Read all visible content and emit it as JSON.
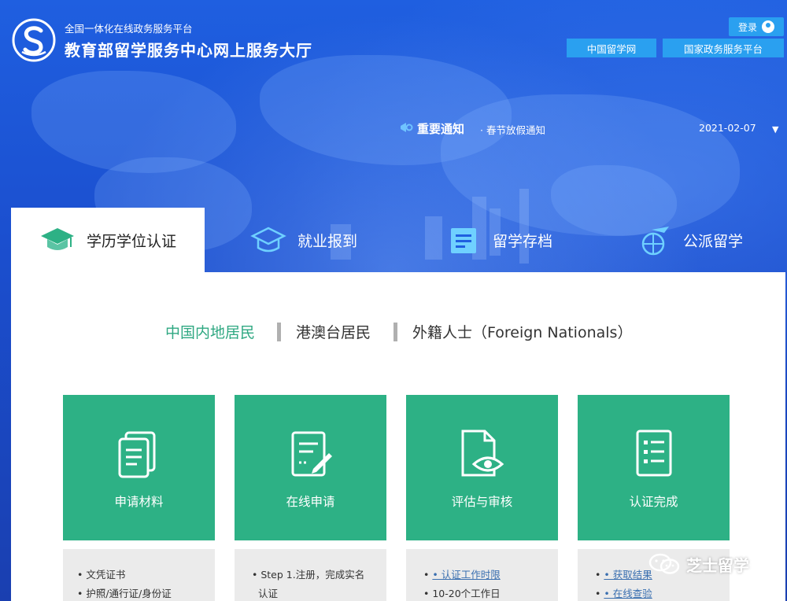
{
  "brand": {
    "subtitle": "全国一体化在线政务服务平台",
    "title": "教育部留学服务中心网上服务大厅"
  },
  "header": {
    "login_label": "登录",
    "links": [
      "中国留学网",
      "国家政务服务平台"
    ]
  },
  "notice": {
    "title": "重要通知",
    "item": "· 春节放假通知",
    "date": "2021-02-07",
    "caret": "▼"
  },
  "tabs": [
    {
      "label": "学历学位认证",
      "icon": "graduation-cap-icon",
      "active": true
    },
    {
      "label": "就业报到",
      "icon": "mortarboard-icon",
      "active": false
    },
    {
      "label": "留学存档",
      "icon": "archive-folder-icon",
      "active": false
    },
    {
      "label": "公派留学",
      "icon": "airplane-globe-icon",
      "active": false
    }
  ],
  "segments": [
    {
      "label": "中国内地居民",
      "active": true
    },
    {
      "label": "港澳台居民",
      "active": false
    },
    {
      "label": "外籍人士（Foreign Nationals）",
      "active": false
    }
  ],
  "steps": [
    {
      "label": "申请材料",
      "icon": "documents-icon"
    },
    {
      "label": "在线申请",
      "icon": "form-edit-icon"
    },
    {
      "label": "评估与审核",
      "icon": "document-eye-icon"
    },
    {
      "label": "认证完成",
      "icon": "checklist-icon"
    }
  ],
  "info": [
    {
      "lines": [
        "• 文凭证书",
        "• 护照/通行证/身份证"
      ]
    },
    {
      "lines": [
        "• Step 1.注册，完成实名",
        "认证"
      ]
    },
    {
      "lines": [
        "• 认证工作时限",
        "• 10-20个工作日"
      ],
      "links": [
        0
      ]
    },
    {
      "lines": [
        "• 获取结果",
        "• 在线查验"
      ],
      "links": [
        0,
        1
      ]
    }
  ],
  "watermark": "芝士留学",
  "colors": {
    "accent_green": "#2db185",
    "brand_blue": "#1f5fe0",
    "link_blue": "#2aa0f0"
  }
}
